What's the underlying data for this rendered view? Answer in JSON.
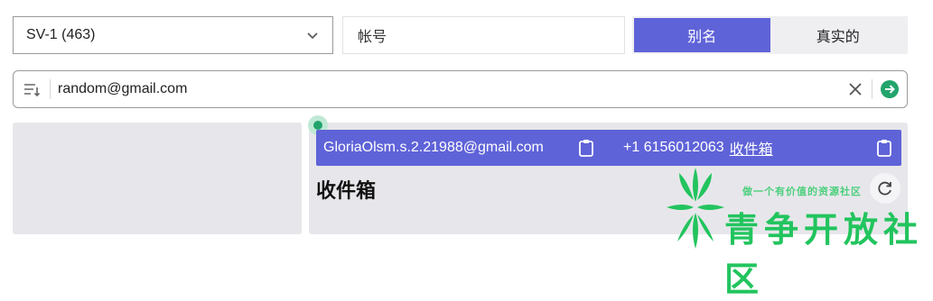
{
  "server_select": {
    "value": "SV-1 (463)"
  },
  "account_field": {
    "value": "帐号"
  },
  "mode_toggle": {
    "options": [
      "别名",
      "真实的"
    ],
    "active": 0
  },
  "search": {
    "value": "random@gmail.com"
  },
  "result": {
    "email": "GloriaOlsm.s.2.21988@gmail.com",
    "phone": "+1 6156012063",
    "inbox_link": "收件箱",
    "heading": "收件箱"
  },
  "watermark": {
    "tagline": "做一个有价值的资源社区",
    "name": "青争开放社区"
  },
  "icons": [
    "chevron-down-icon",
    "sort-icon",
    "close-icon",
    "arrow-right-circle-icon",
    "clipboard-icon",
    "refresh-icon",
    "watermark-logo-icon"
  ],
  "colors": {
    "accent": "#5f63d8",
    "panel": "#e7e7eb",
    "go": "#22a46c",
    "watermark": "#22c45e"
  }
}
